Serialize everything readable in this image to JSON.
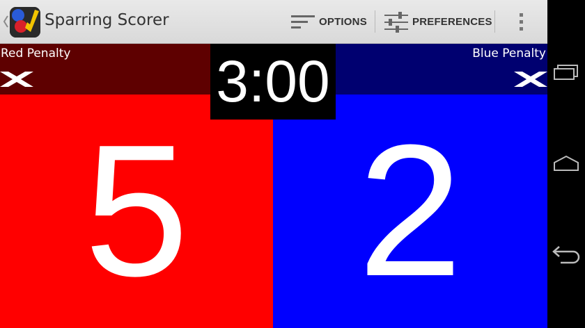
{
  "app": {
    "title": "Sparring Scorer"
  },
  "action_bar": {
    "options_label": "OPTIONS",
    "preferences_label": "PREFERENCES",
    "options_icon": "sort-lines-icon",
    "preferences_icon": "sliders-icon",
    "overflow_icon": "more-vertical-icon"
  },
  "penalties": {
    "red_label": "Red Penalty",
    "blue_label": "Blue Penalty",
    "mark_icon": "x-icon"
  },
  "timer": {
    "value": "3:00"
  },
  "scores": {
    "red": "5",
    "blue": "2"
  },
  "colors": {
    "red_score_bg": "#ff0000",
    "blue_score_bg": "#0000ff",
    "red_penalty_bg": "#5e0000",
    "blue_penalty_bg": "#000070",
    "timer_bg": "#000000"
  },
  "navigation": {
    "recents_icon": "recent-apps-icon",
    "home_icon": "home-icon",
    "back_icon": "back-arrow-icon"
  }
}
